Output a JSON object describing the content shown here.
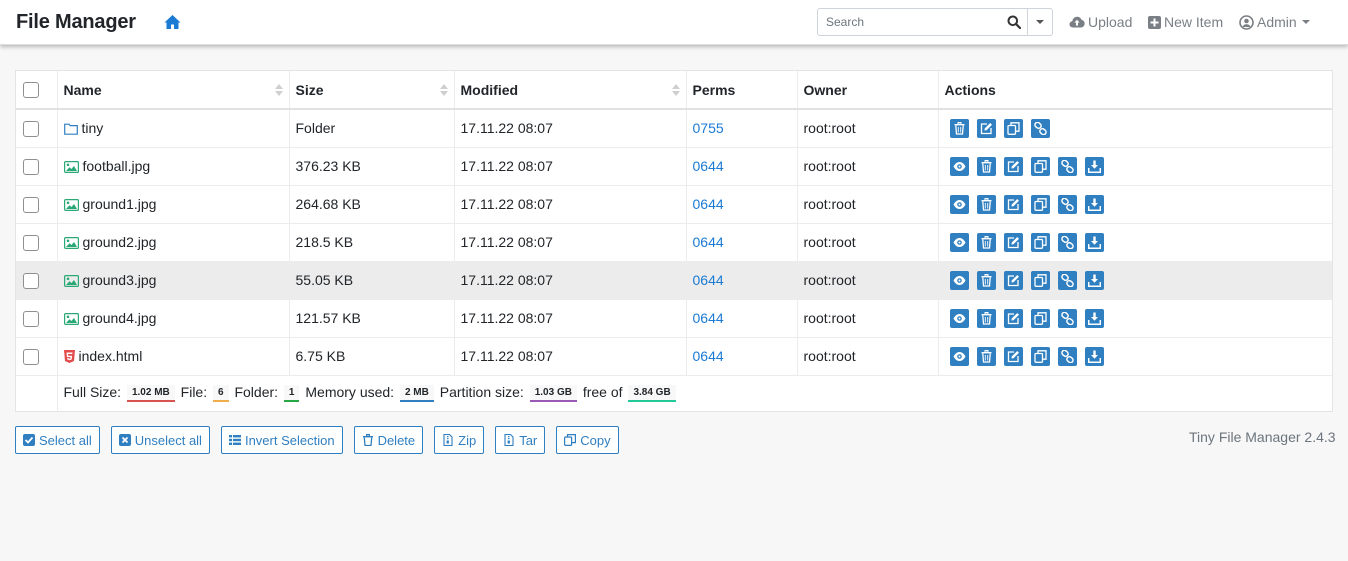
{
  "header": {
    "brand": "File Manager",
    "search_placeholder": "Search",
    "upload_label": "Upload",
    "new_item_label": "New Item",
    "admin_label": "Admin"
  },
  "table": {
    "columns": [
      "Name",
      "Size",
      "Modified",
      "Perms",
      "Owner",
      "Actions"
    ],
    "rows": [
      {
        "name": "tiny",
        "size": "Folder",
        "modified": "17.11.22 08:07",
        "perms": "0755",
        "owner": "root:root",
        "type": "folder"
      },
      {
        "name": "football.jpg",
        "size": "376.23 KB",
        "modified": "17.11.22 08:07",
        "perms": "0644",
        "owner": "root:root",
        "type": "image"
      },
      {
        "name": "ground1.jpg",
        "size": "264.68 KB",
        "modified": "17.11.22 08:07",
        "perms": "0644",
        "owner": "root:root",
        "type": "image"
      },
      {
        "name": "ground2.jpg",
        "size": "218.5 KB",
        "modified": "17.11.22 08:07",
        "perms": "0644",
        "owner": "root:root",
        "type": "image"
      },
      {
        "name": "ground3.jpg",
        "size": "55.05 KB",
        "modified": "17.11.22 08:07",
        "perms": "0644",
        "owner": "root:root",
        "type": "image"
      },
      {
        "name": "ground4.jpg",
        "size": "121.57 KB",
        "modified": "17.11.22 08:07",
        "perms": "0644",
        "owner": "root:root",
        "type": "image"
      },
      {
        "name": "index.html",
        "size": "6.75 KB",
        "modified": "17.11.22 08:07",
        "perms": "0644",
        "owner": "root:root",
        "type": "html"
      }
    ]
  },
  "footer_stats": {
    "full_size_label": "Full Size:",
    "full_size": "1.02 MB",
    "file_label": "File:",
    "file_count": "6",
    "folder_label": "Folder:",
    "folder_count": "1",
    "memory_label": "Memory used:",
    "memory": "2 MB",
    "partition_label": "Partition size:",
    "partition": "1.03 GB",
    "free_label": "free of",
    "free": "3.84 GB"
  },
  "buttons": {
    "select_all": "Select all",
    "unselect_all": "Unselect all",
    "invert": "Invert Selection",
    "delete": "Delete",
    "zip": "Zip",
    "tar": "Tar",
    "copy": "Copy"
  },
  "version": "Tiny File Manager 2.4.3",
  "colors": {
    "accent": "#2f7fc1",
    "link": "#1a7ad4",
    "image_icon": "#2aa876",
    "html_icon": "#e34c4c"
  }
}
